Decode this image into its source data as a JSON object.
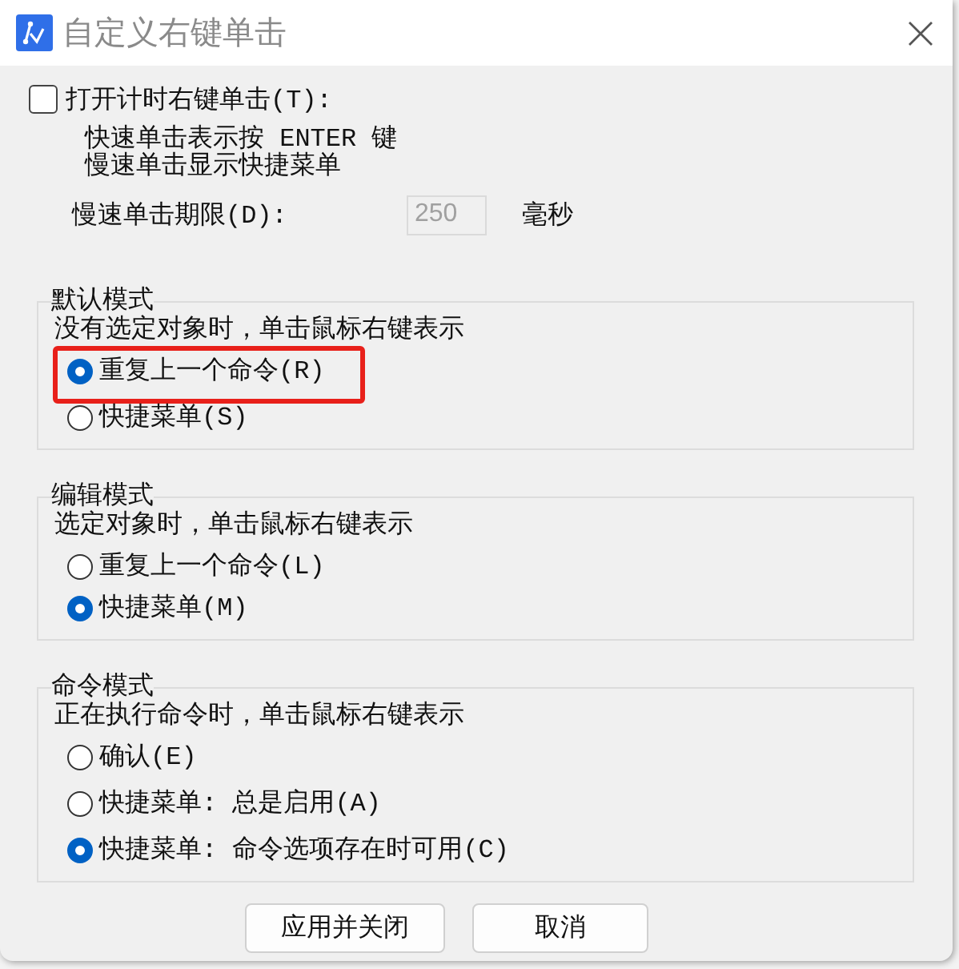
{
  "window": {
    "title": "自定义右键单击"
  },
  "timed_click": {
    "label": "打开计时右键单击(T):",
    "checked": false,
    "notes": [
      "快速单击表示按 ENTER 键",
      "慢速单击显示快捷菜单"
    ],
    "duration": {
      "label": "慢速单击期限(D):",
      "value": "250",
      "unit": "毫秒",
      "disabled": true
    }
  },
  "groups": [
    {
      "title": "默认模式",
      "description": "没有选定对象时，单击鼠标右键表示",
      "options": [
        {
          "label": "重复上一个命令(R)",
          "selected": true,
          "highlighted": true
        },
        {
          "label": "快捷菜单(S)",
          "selected": false,
          "highlighted": false
        }
      ]
    },
    {
      "title": "编辑模式",
      "description": "选定对象时，单击鼠标右键表示",
      "options": [
        {
          "label": "重复上一个命令(L)",
          "selected": false,
          "highlighted": false
        },
        {
          "label": "快捷菜单(M)",
          "selected": true,
          "highlighted": false
        }
      ]
    },
    {
      "title": "命令模式",
      "description": "正在执行命令时，单击鼠标右键表示",
      "options": [
        {
          "label": "确认(E)",
          "selected": false,
          "highlighted": false
        },
        {
          "label": "快捷菜单: 总是启用(A)",
          "selected": false,
          "highlighted": false
        },
        {
          "label": "快捷菜单: 命令选项存在时可用(C)",
          "selected": true,
          "highlighted": false
        }
      ]
    }
  ],
  "buttons": [
    {
      "label": "应用并关闭"
    },
    {
      "label": "取消"
    }
  ]
}
